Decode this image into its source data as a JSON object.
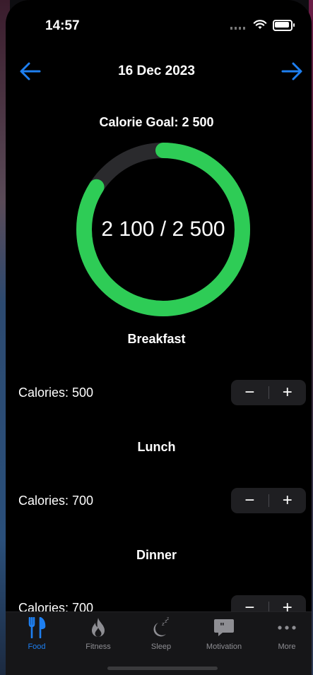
{
  "status": {
    "time": "14:57"
  },
  "header": {
    "date": "16 Dec 2023"
  },
  "goal": {
    "label": "Calorie Goal: 2 500"
  },
  "progress": {
    "text": "2 100 / 2 500",
    "consumed": 2100,
    "goal": 2500,
    "fraction": 0.84
  },
  "meals": [
    {
      "title": "Breakfast",
      "calories": "Calories: 500"
    },
    {
      "title": "Lunch",
      "calories": "Calories: 700"
    },
    {
      "title": "Dinner",
      "calories": "Calories: 700"
    }
  ],
  "stepper": {
    "minus": "−",
    "plus": "+"
  },
  "tabs": [
    {
      "label": "Food",
      "icon": "fork-knife-icon",
      "active": true
    },
    {
      "label": "Fitness",
      "icon": "flame-icon"
    },
    {
      "label": "Sleep",
      "icon": "moon-zzz-icon"
    },
    {
      "label": "Motivation",
      "icon": "quote-bubble-icon"
    },
    {
      "label": "More",
      "icon": "ellipsis-icon"
    }
  ],
  "colors": {
    "accent": "#1e7ff0",
    "ring": "#2ecc56",
    "track": "#2a2a2d"
  }
}
